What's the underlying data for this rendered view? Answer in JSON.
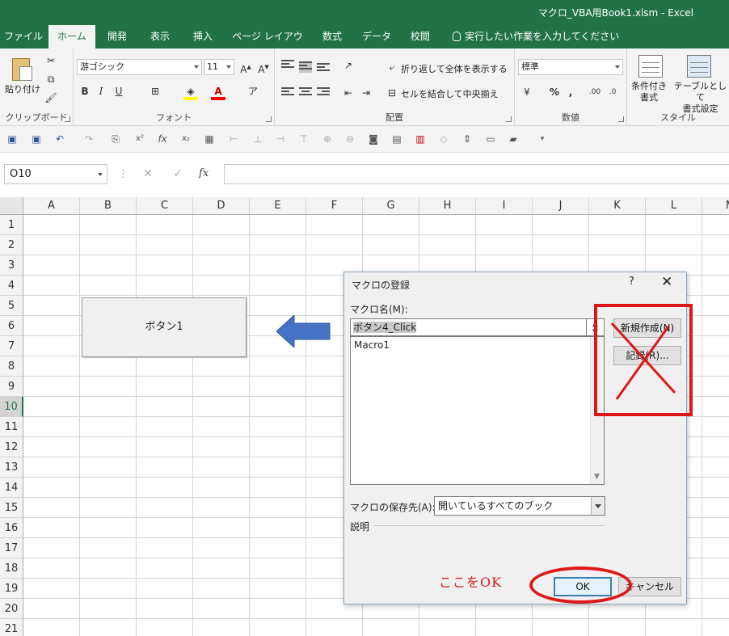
{
  "window": {
    "title": "マクロ_VBA用Book1.xlsm  -  Excel"
  },
  "tabs": [
    "ファイル",
    "ホーム",
    "開発",
    "表示",
    "挿入",
    "ページ レイアウト",
    "数式",
    "データ",
    "校閲"
  ],
  "tell_me": "実行したい作業を入力してください",
  "ribbon": {
    "clipboard": {
      "paste_label": "貼り付け",
      "group": "クリップボード"
    },
    "font": {
      "font_name": "游ゴシック",
      "font_size": "11",
      "group": "フォント",
      "bold": "B",
      "italic": "I",
      "underline": "U"
    },
    "alignment": {
      "wrap_text": "折り返して全体を表示する",
      "merge_center": "セルを結合して中央揃え",
      "group": "配置"
    },
    "number": {
      "format": "標準",
      "group": "数値"
    },
    "styles": {
      "conditional": "条件付き\n書式",
      "table": "テーブルとして\n書式設定",
      "group": "スタイル"
    }
  },
  "formula_bar": {
    "name_box": "O10",
    "cancel": "✕",
    "enter": "✓",
    "fx": "fx",
    "value": ""
  },
  "grid": {
    "columns": [
      "A",
      "B",
      "C",
      "D",
      "E",
      "F",
      "G",
      "H",
      "I",
      "J",
      "K",
      "L",
      "M"
    ],
    "rows": [
      "1",
      "2",
      "3",
      "4",
      "5",
      "6",
      "7",
      "8",
      "9",
      "10",
      "11",
      "12",
      "13",
      "14",
      "15",
      "16",
      "17",
      "18",
      "19",
      "20",
      "21"
    ],
    "active_row": "10"
  },
  "sheet_button": {
    "label": "ボタン1"
  },
  "dialog": {
    "title": "マクロの登録",
    "help": "?",
    "close": "✕",
    "macro_name_label": "マクロ名(M):",
    "macro_name_value": "ボタン4_Click",
    "macro_list": [
      "Macro1"
    ],
    "new_button": "新規作成(N)",
    "record_button": "記録(R)...",
    "save_in_label": "マクロの保存先(A):",
    "save_in_value": "開いているすべてのブック",
    "description_label": "説明",
    "ok_button": "OK",
    "cancel_button": "キャンセル"
  },
  "annotation": {
    "text": "ここをOK",
    "color": "#dd1818"
  },
  "colors": {
    "excel_green": "#217346",
    "arrow_blue": "#4472c4"
  }
}
